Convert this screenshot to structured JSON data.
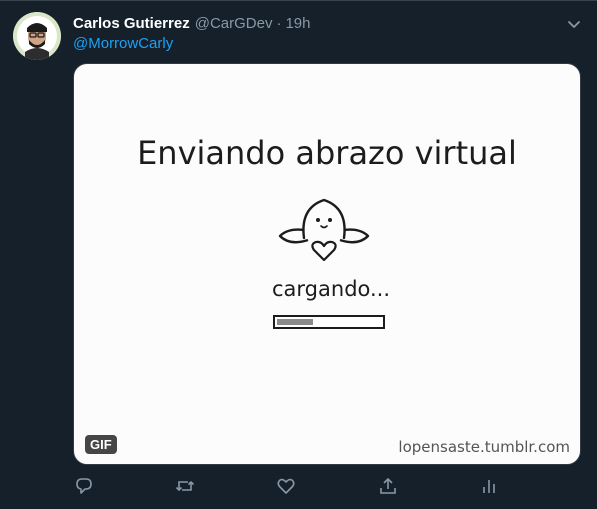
{
  "tweet": {
    "author_name": "Carlos Gutierrez",
    "handle": "@CarGDev",
    "separator": "·",
    "time": "19h",
    "reply_to": "@MorrowCarly"
  },
  "media": {
    "title": "Enviando abrazo virtual",
    "loading_text": "cargando...",
    "progress": 0.35,
    "watermark": "lopensaste.tumblr.com",
    "badge": "GIF"
  },
  "icons": {
    "menu": "chevron-down-icon",
    "reply": "reply-icon",
    "retweet": "retweet-icon",
    "like": "heart-icon",
    "share": "share-icon",
    "analytics": "analytics-icon"
  },
  "colors": {
    "background": "#15202b",
    "accent": "#1da1f2",
    "muted": "#8899a6",
    "text": "#ffffff"
  }
}
